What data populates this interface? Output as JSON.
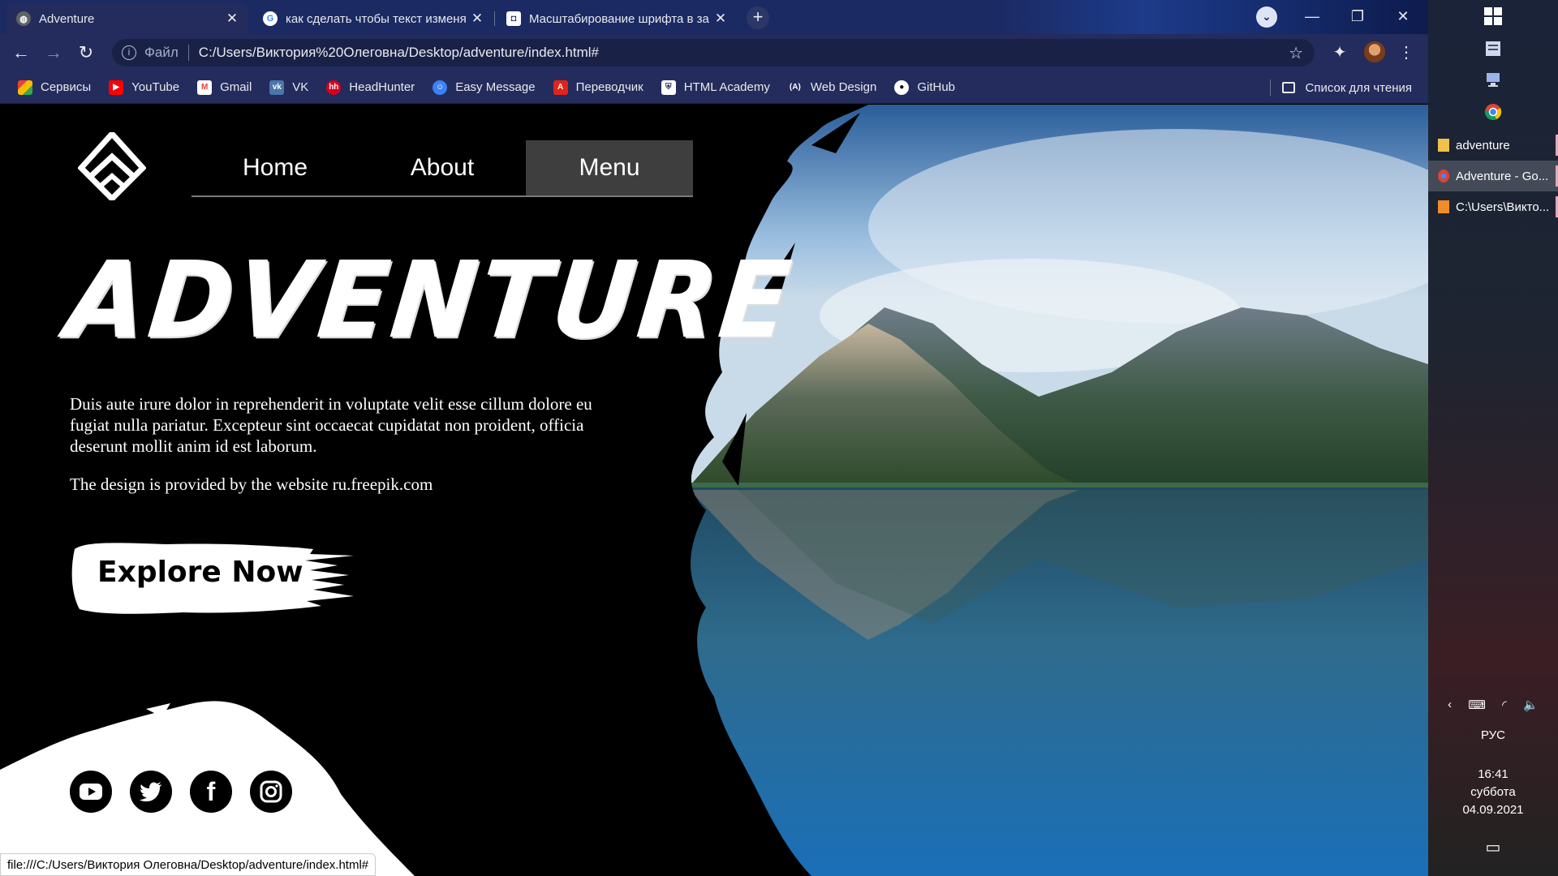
{
  "browser": {
    "tabs": [
      {
        "title": "Adventure",
        "active": true
      },
      {
        "title": "как сделать чтобы текст изменя",
        "active": false
      },
      {
        "title": "Масштабирование шрифта в за",
        "active": false
      }
    ],
    "new_tab": "+",
    "address": {
      "scheme_label": "Файл",
      "url": "C:/Users/Виктория%20Олеговна/Desktop/adventure/index.html#"
    },
    "bookmarks": [
      {
        "label": "Сервисы",
        "icon": "apps-grid-icon",
        "color": "#ea4335"
      },
      {
        "label": "YouTube",
        "icon": "youtube-icon",
        "color": "#ff0000"
      },
      {
        "label": "Gmail",
        "icon": "gmail-icon",
        "color": "#ea4335"
      },
      {
        "label": "VK",
        "icon": "vk-icon",
        "color": "#4a76a8"
      },
      {
        "label": "HeadHunter",
        "icon": "headhunter-icon",
        "color": "#d6001c"
      },
      {
        "label": "Easy Message",
        "icon": "easy-message-icon",
        "color": "#3b82f6"
      },
      {
        "label": "Переводчик",
        "icon": "translator-icon",
        "color": "#e2231a"
      },
      {
        "label": "HTML Academy",
        "icon": "html-academy-icon",
        "color": "#ffffff"
      },
      {
        "label": "Web Design",
        "icon": "web-design-icon",
        "color": "#ffffff"
      },
      {
        "label": "GitHub",
        "icon": "github-icon",
        "color": "#ffffff"
      }
    ],
    "reading_list": "Список для чтения",
    "status_url": "file:///C:/Users/Виктория Олеговна/Desktop/adventure/index.html#"
  },
  "site": {
    "nav": [
      {
        "label": "Home",
        "active": false
      },
      {
        "label": "About",
        "active": false
      },
      {
        "label": "Menu",
        "active": true
      }
    ],
    "hero_title": "ADVENTURE",
    "hero_text": "Duis aute irure dolor in reprehenderit in voluptate velit esse cillum dolore eu fugiat nulla pariatur. Excepteur sint occaecat cupidatat non proident, officia deserunt mollit anim id est laborum.",
    "credit_prefix": "The design is provided by the website ",
    "credit_link": "ru.freepik.com",
    "cta": "Explore Now",
    "social": [
      "youtube-icon",
      "twitter-icon",
      "facebook-icon",
      "instagram-icon"
    ]
  },
  "taskbar": {
    "windows": [
      {
        "label": "adventure",
        "icon": "folder-icon",
        "active": false
      },
      {
        "label": "Adventure - Go...",
        "icon": "chrome-icon",
        "active": true
      },
      {
        "label": "C:\\Users\\Викто...",
        "icon": "sublime-icon",
        "active": false
      }
    ],
    "language": "РУС",
    "time": "16:41",
    "day": "суббота",
    "date": "04.09.2021"
  },
  "colors": {
    "chrome_bg": "#232c5c",
    "nav_active": "#3e3e3e",
    "page_bg": "#000000"
  }
}
